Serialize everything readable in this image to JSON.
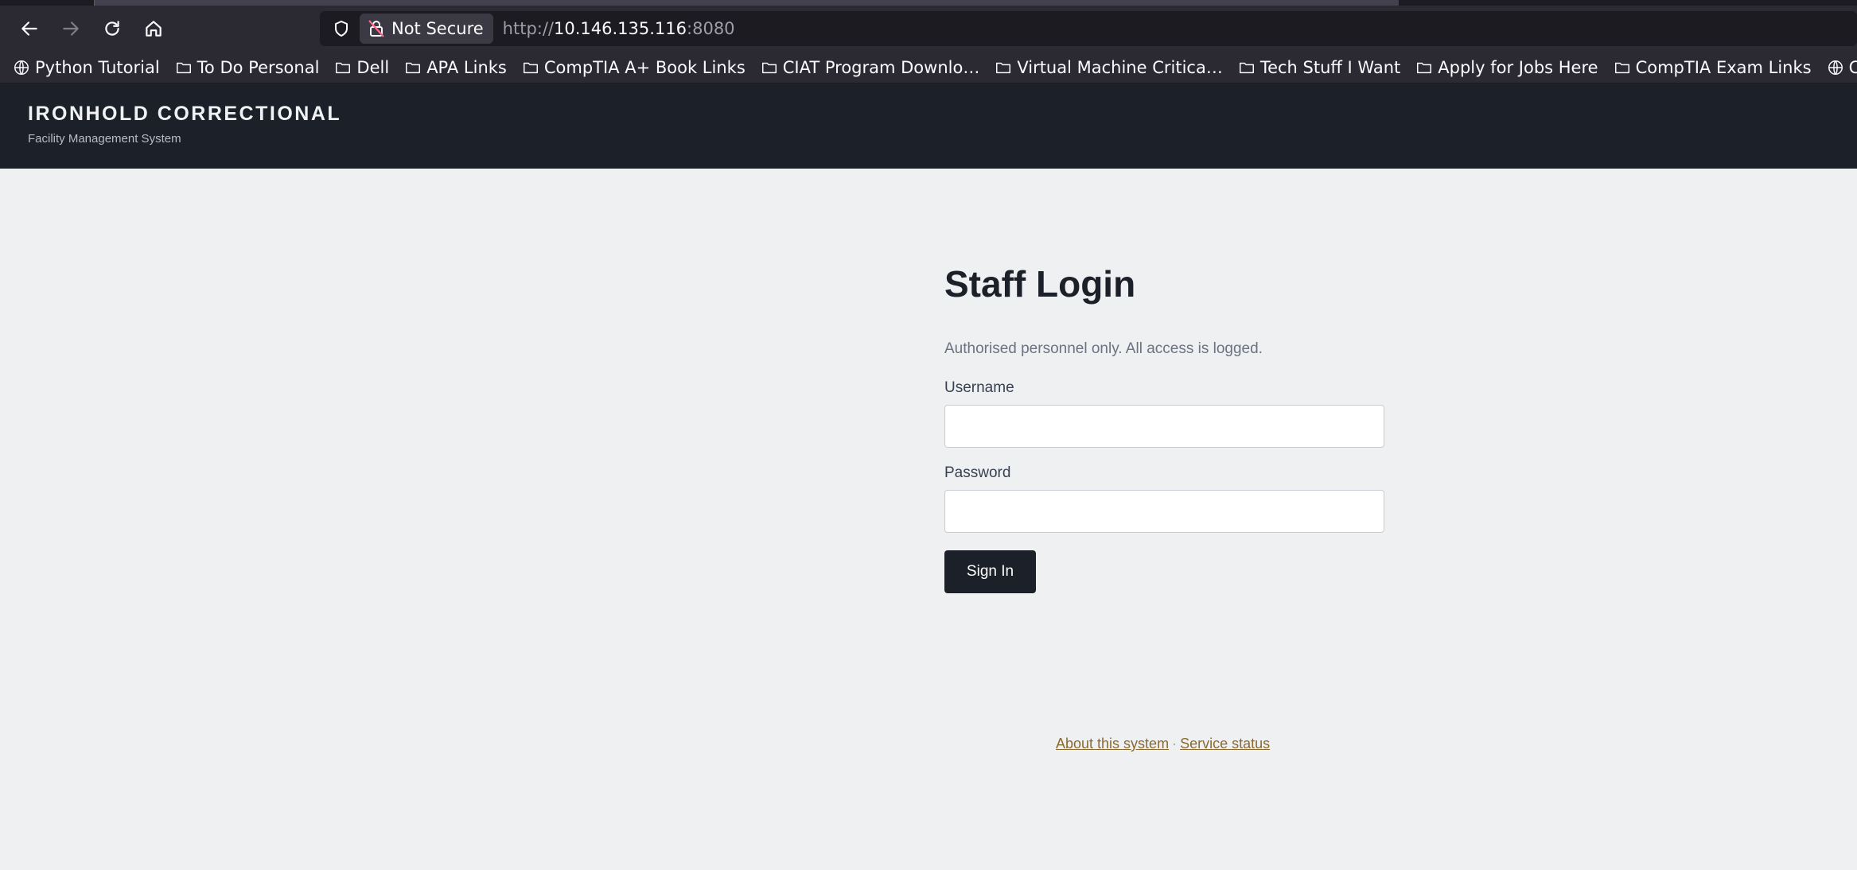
{
  "browser": {
    "security_label": "Not Secure",
    "url_scheme": "http://",
    "url_host": "10.146.135.116",
    "url_port": ":8080",
    "bookmarks": [
      {
        "label": "Python Tutorial",
        "icon": "globe-icon"
      },
      {
        "label": "To Do Personal",
        "icon": "folder-icon"
      },
      {
        "label": "Dell",
        "icon": "folder-icon"
      },
      {
        "label": "APA Links",
        "icon": "folder-icon"
      },
      {
        "label": "CompTIA A+ Book Links",
        "icon": "folder-icon"
      },
      {
        "label": "CIAT Program Downlo…",
        "icon": "folder-icon"
      },
      {
        "label": "Virtual Machine Critica…",
        "icon": "folder-icon"
      },
      {
        "label": "Tech Stuff I Want",
        "icon": "folder-icon"
      },
      {
        "label": "Apply for Jobs Here",
        "icon": "folder-icon"
      },
      {
        "label": "CompTIA Exam Links",
        "icon": "folder-icon"
      },
      {
        "label": "CSAC - Student I",
        "icon": "globe-icon"
      }
    ]
  },
  "header": {
    "title": "IRONHOLD CORRECTIONAL",
    "subtitle": "Facility Management System"
  },
  "login": {
    "title": "Staff Login",
    "note": "Authorised personnel only. All access is logged.",
    "username_label": "Username",
    "username_value": "",
    "password_label": "Password",
    "password_value": "",
    "submit_label": "Sign In"
  },
  "footer": {
    "about_link": "About this system",
    "separator": "·",
    "status_link": "Service status"
  },
  "colors": {
    "header_bg": "#1c2029",
    "page_bg": "#eff0f2",
    "button_bg": "#1c2029",
    "link": "#8a6a2e"
  }
}
